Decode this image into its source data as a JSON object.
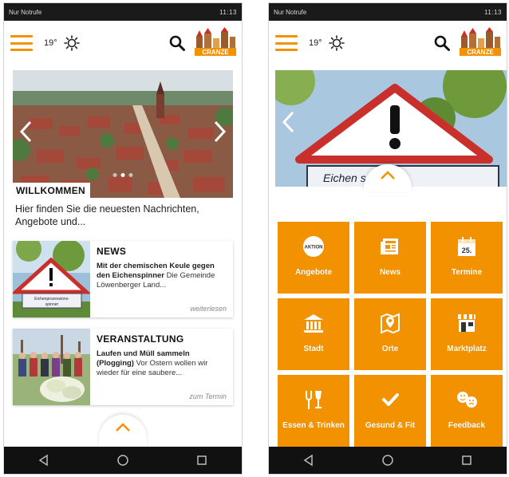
{
  "status_bar": {
    "left": "Nur Notrufe",
    "right": "11:13"
  },
  "header": {
    "temperature": "19°",
    "weather_icon": "sun-icon",
    "logo_text": "CRANZE"
  },
  "home": {
    "slider_label": "WILLKOMMEN",
    "slider_text": "Hier finden Sie die neuesten Nachrichten, Angebote und...",
    "cards": [
      {
        "category": "NEWS",
        "title": "Mit der chemischen Keule gegen den Eichenspinner",
        "excerpt": "Die Gemeinde Löwenberger Land...",
        "more": "weiterlesen"
      },
      {
        "category": "VERANSTALTUNG",
        "title": "Laufen und Müll sammeln (Plogging)",
        "excerpt": "Vor Ostern wollen wir wieder für eine saubere...",
        "more": "zum Termin"
      }
    ]
  },
  "menu": {
    "hero_sign_text": "Eichen  ssions-",
    "tiles": [
      {
        "label": "Angebote",
        "icon": "aktion-badge-icon",
        "badge_text": "AKTION"
      },
      {
        "label": "News",
        "icon": "newspaper-icon"
      },
      {
        "label": "Termine",
        "icon": "calendar-icon",
        "badge_text": "25."
      },
      {
        "label": "Stadt",
        "icon": "townhall-icon"
      },
      {
        "label": "Orte",
        "icon": "map-pin-icon"
      },
      {
        "label": "Marktplatz",
        "icon": "shop-icon"
      },
      {
        "label": "Essen & Trinken",
        "icon": "fork-glass-icon"
      },
      {
        "label": "Gesund & Fit",
        "icon": "checkmark-icon"
      },
      {
        "label": "Feedback",
        "icon": "smiley-icon"
      }
    ]
  },
  "colors": {
    "accent": "#f39200",
    "status_bar": "#1a1a1a",
    "nav_bar": "#111111"
  }
}
